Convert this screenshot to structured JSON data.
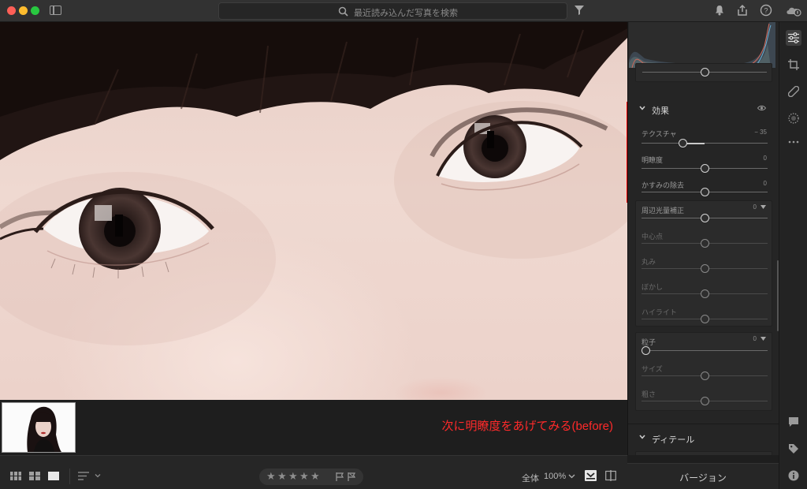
{
  "search": {
    "placeholder": "最近読み込んだ写真を検索"
  },
  "annotation": "次に明瞭度をあげてみる(before)",
  "toolbar": {
    "zoom_label": "全体",
    "zoom_value": "100%",
    "stars": [
      "★",
      "★",
      "★",
      "★",
      "★"
    ],
    "version_label": "バージョン"
  },
  "panel": {
    "effects": {
      "title": "効果",
      "sliders": [
        {
          "label": "テクスチャ",
          "value": "− 35",
          "level": -35
        },
        {
          "label": "明瞭度",
          "value": "0",
          "level": 0
        },
        {
          "label": "かすみの除去",
          "value": "0",
          "level": 0
        }
      ]
    },
    "vignette": {
      "label": "周辺光量補正",
      "value": "0",
      "sub": [
        "中心点",
        "丸み",
        "ぼかし",
        "ハイライト"
      ]
    },
    "grain": {
      "label": "粒子",
      "value": "0",
      "sub": [
        "サイズ",
        "粗さ"
      ]
    },
    "detail": {
      "title": "ディテール"
    }
  },
  "colors": {
    "highlight": "#e00000",
    "annotation": "#ff2a2a",
    "accent": "#c9c9c9"
  },
  "icons": [
    "search-icon",
    "filter-icon",
    "bell-icon",
    "share-icon",
    "help-icon",
    "cloud-icon",
    "edit-sliders-icon",
    "crop-icon",
    "heal-icon",
    "masking-icon",
    "more-icon",
    "comment-icon",
    "tag-icon",
    "info-icon",
    "eye-icon",
    "chevron-down-icon"
  ]
}
